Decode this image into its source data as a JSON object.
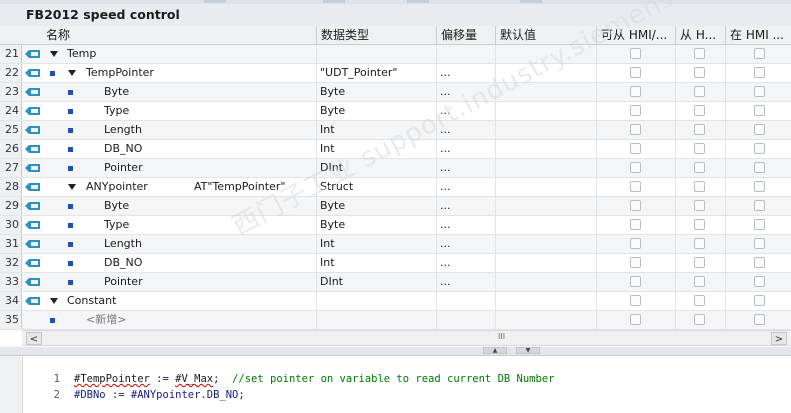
{
  "title": "FB2012 speed control",
  "columns": {
    "name": "名称",
    "datatype": "数据类型",
    "offset": "偏移量",
    "default": "默认值",
    "hmi_access": "可从 HMI/...",
    "hmi_visible": "从 H...",
    "hmi_setpoint": "在 HMI ..."
  },
  "rows": [
    {
      "num": "21",
      "level": 0,
      "expand": true,
      "bullet": false,
      "icon": true,
      "name": "Temp",
      "at": "",
      "type": "",
      "offset": "",
      "checks": true
    },
    {
      "num": "22",
      "level": 1,
      "expand": true,
      "bullet": true,
      "icon": true,
      "name": "TempPointer",
      "at": "",
      "type": "\"UDT_Pointer\"",
      "offset": "...",
      "checks": true
    },
    {
      "num": "23",
      "level": 2,
      "expand": false,
      "bullet": true,
      "icon": true,
      "name": "Byte",
      "at": "",
      "type": "Byte",
      "offset": "...",
      "checks": true
    },
    {
      "num": "24",
      "level": 2,
      "expand": false,
      "bullet": true,
      "icon": true,
      "name": "Type",
      "at": "",
      "type": "Byte",
      "offset": "...",
      "checks": true
    },
    {
      "num": "25",
      "level": 2,
      "expand": false,
      "bullet": true,
      "icon": true,
      "name": "Length",
      "at": "",
      "type": "Int",
      "offset": "...",
      "checks": true
    },
    {
      "num": "26",
      "level": 2,
      "expand": false,
      "bullet": true,
      "icon": true,
      "name": "DB_NO",
      "at": "",
      "type": "Int",
      "offset": "...",
      "checks": true
    },
    {
      "num": "27",
      "level": 2,
      "expand": false,
      "bullet": true,
      "icon": true,
      "name": "Pointer",
      "at": "",
      "type": "DInt",
      "offset": "...",
      "checks": true
    },
    {
      "num": "28",
      "level": 1,
      "expand": true,
      "bullet": false,
      "icon": true,
      "name": "ANYpointer",
      "at": "AT\"TempPointer\"",
      "type": "Struct",
      "offset": "...",
      "checks": true
    },
    {
      "num": "29",
      "level": 2,
      "expand": false,
      "bullet": true,
      "icon": true,
      "name": "Byte",
      "at": "",
      "type": "Byte",
      "offset": "...",
      "checks": true
    },
    {
      "num": "30",
      "level": 2,
      "expand": false,
      "bullet": true,
      "icon": true,
      "name": "Type",
      "at": "",
      "type": "Byte",
      "offset": "...",
      "checks": true
    },
    {
      "num": "31",
      "level": 2,
      "expand": false,
      "bullet": true,
      "icon": true,
      "name": "Length",
      "at": "",
      "type": "Int",
      "offset": "...",
      "checks": true
    },
    {
      "num": "32",
      "level": 2,
      "expand": false,
      "bullet": true,
      "icon": true,
      "name": "DB_NO",
      "at": "",
      "type": "Int",
      "offset": "...",
      "checks": true
    },
    {
      "num": "33",
      "level": 2,
      "expand": false,
      "bullet": true,
      "icon": true,
      "name": "Pointer",
      "at": "",
      "type": "DInt",
      "offset": "...",
      "checks": true
    },
    {
      "num": "34",
      "level": 0,
      "expand": true,
      "bullet": false,
      "icon": true,
      "name": "Constant",
      "at": "",
      "type": "",
      "offset": "",
      "checks": true
    },
    {
      "num": "35",
      "level": 1,
      "expand": false,
      "bullet": true,
      "icon": false,
      "name": "<新增>",
      "at": "",
      "type": "",
      "offset": "",
      "checks": true,
      "placeholder": true
    }
  ],
  "scrollbar": {
    "left_arrow": "<",
    "right_arrow": ">",
    "thumb": "III"
  },
  "code": [
    {
      "ln": "1",
      "parts": [
        {
          "t": "#TempPointer",
          "c": "err"
        },
        {
          "t": " := ",
          "c": ""
        },
        {
          "t": "#V_Max",
          "c": "err"
        },
        {
          "t": ";",
          "c": ""
        },
        {
          "t": "  //set pointer on variable to read current DB Number",
          "c": "cm"
        }
      ]
    },
    {
      "ln": "2",
      "parts": [
        {
          "t": "#DBNo := #ANYpointer.DB_NO;",
          "c": ""
        }
      ]
    }
  ],
  "watermark": "西门子工业  support.industry.siemens.com/cs  找答案",
  "colors": {
    "accent": "#1f4fb8",
    "icon_teal": "#2f8fbf",
    "comment": "#007a00",
    "error": "#d00000"
  }
}
